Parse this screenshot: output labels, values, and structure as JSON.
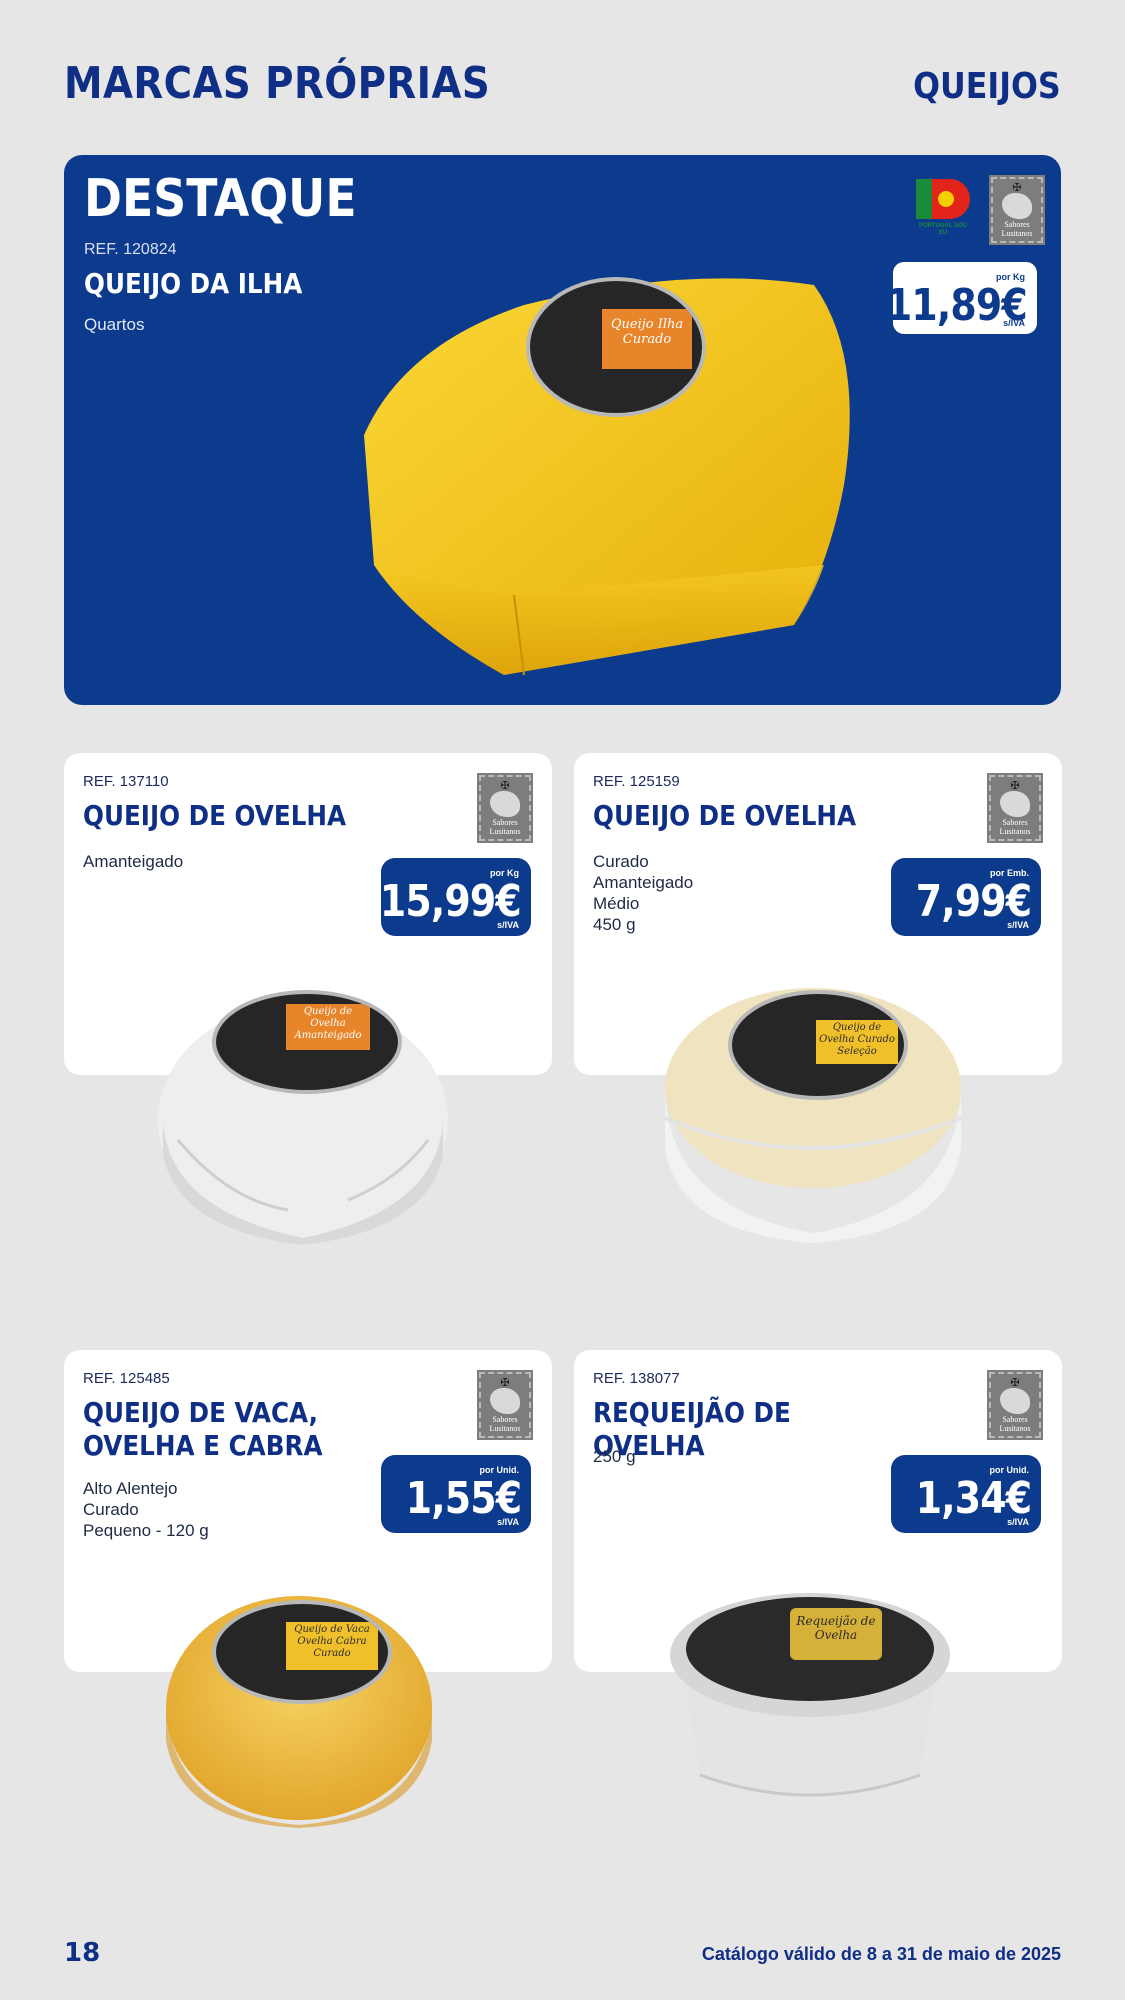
{
  "header": {
    "title": "MARCAS PRÓPRIAS",
    "section": "QUEIJOS"
  },
  "featured": {
    "kicker": "DESTAQUE",
    "ref": "REF. 120824",
    "name": "QUEIJO DA ILHA",
    "description": "Quartos",
    "price": {
      "unit": "por Kg",
      "value": "11,89€",
      "tax": "s/IVA"
    },
    "logos": {
      "pt": "PORTUGAL SOU EU",
      "seal": "Sabores Lusitanos"
    },
    "label_text": "Queijo Ilha Curado"
  },
  "products": [
    {
      "ref": "REF. 137110",
      "name": "QUEIJO DE OVELHA",
      "description": [
        "Amanteigado"
      ],
      "price": {
        "unit": "por Kg",
        "value": "15,99€",
        "tax": "s/IVA"
      },
      "seal": "Sabores Lusitanos",
      "label_text": "Queijo de Ovelha Amanteigado"
    },
    {
      "ref": "REF. 125159",
      "name": "QUEIJO DE OVELHA",
      "description": [
        "Curado",
        "Amanteigado",
        "Médio",
        "450 g"
      ],
      "price": {
        "unit": "por Emb.",
        "value": "7,99€",
        "tax": "s/IVA"
      },
      "seal": "Sabores Lusitanos",
      "label_text": "Queijo de Ovelha Curado Seleção"
    },
    {
      "ref": "REF. 125485",
      "name": "QUEIJO DE VACA, OVELHA E CABRA",
      "description": [
        "Alto Alentejo",
        "Curado",
        "Pequeno - 120 g"
      ],
      "price": {
        "unit": "por Unid.",
        "value": "1,55€",
        "tax": "s/IVA"
      },
      "seal": "Sabores Lusitanos",
      "label_text": "Queijo de Vaca Ovelha Cabra Curado"
    },
    {
      "ref": "REF. 138077",
      "name": "REQUEIJÃO DE OVELHA",
      "description": [
        "250 g"
      ],
      "price": {
        "unit": "por Unid.",
        "value": "1,34€",
        "tax": "s/IVA"
      },
      "seal": "Sabores Lusitanos",
      "label_text": "Requeijão de Ovelha"
    }
  ],
  "footer": {
    "page": "18",
    "validity": "Catálogo válido de 8 a 31 de maio de 2025"
  },
  "colors": {
    "brand_blue": "#0c3a8c",
    "title_blue": "#0f2f86",
    "background": "#e6e6e7",
    "cheese_yellow": "#f2c418"
  }
}
